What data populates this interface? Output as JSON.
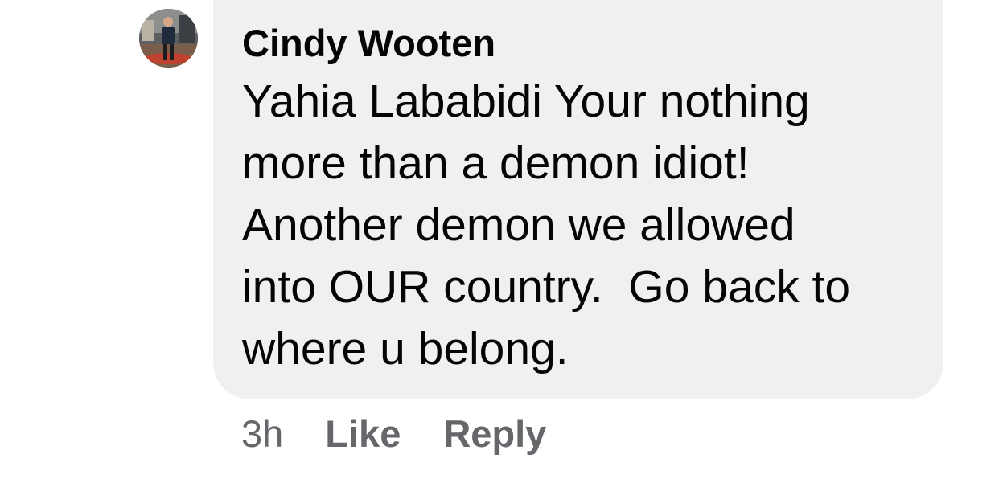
{
  "comment": {
    "author": "Cindy Wooten",
    "text_lines": [
      "Yahia Lababidi Your nothing",
      "more than a demon idiot!",
      "Another demon we allowed",
      "into OUR country.  Go back to",
      "where u belong."
    ],
    "timestamp": "3h",
    "like_label": "Like",
    "reply_label": "Reply"
  },
  "colors": {
    "bubble_background": "#eff0f2",
    "text": "#050505",
    "secondary_text": "#65676b"
  },
  "icons": {
    "avatar": "profile-photo-avatar"
  }
}
